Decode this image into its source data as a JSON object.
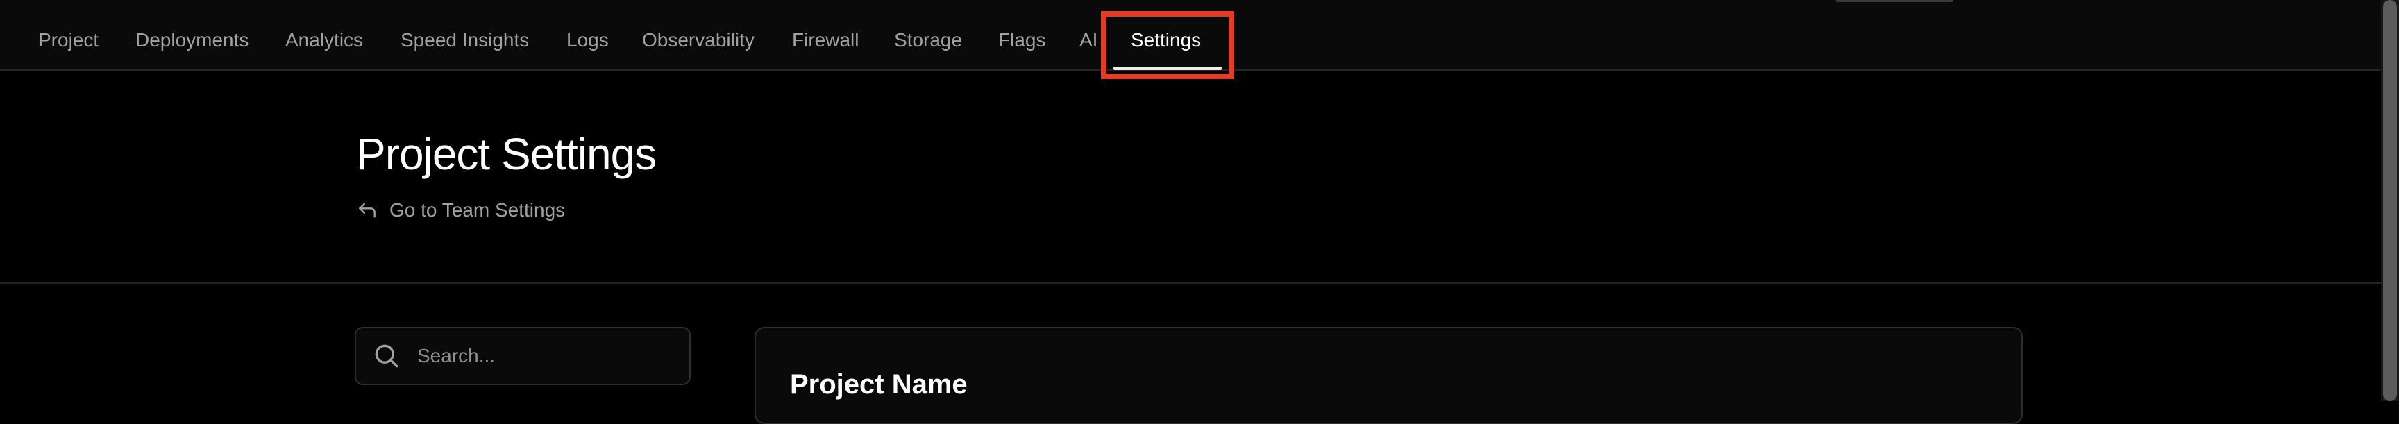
{
  "nav": {
    "items": [
      {
        "label": "Project",
        "active": false
      },
      {
        "label": "Deployments",
        "active": false
      },
      {
        "label": "Analytics",
        "active": false
      },
      {
        "label": "Speed Insights",
        "active": false
      },
      {
        "label": "Logs",
        "active": false
      },
      {
        "label": "Observability",
        "active": false
      },
      {
        "label": "Firewall",
        "active": false
      },
      {
        "label": "Storage",
        "active": false
      },
      {
        "label": "Flags",
        "active": false
      },
      {
        "label": "AI",
        "active": false
      },
      {
        "label": "Settings",
        "active": true
      }
    ]
  },
  "header": {
    "title": "Project Settings",
    "back_link": "Go to Team Settings",
    "back_icon": "arrow-return-left-icon"
  },
  "sidebar": {
    "search": {
      "placeholder": "Search...",
      "value": "",
      "icon": "search-icon"
    }
  },
  "main": {
    "sections": [
      {
        "title": "Project Name"
      }
    ]
  },
  "colors": {
    "background": "#000000",
    "nav_background": "#0a0a0a",
    "border": "#242424",
    "text_primary": "#ffffff",
    "text_secondary": "#a1a1a1",
    "highlight": "#e33b26"
  }
}
